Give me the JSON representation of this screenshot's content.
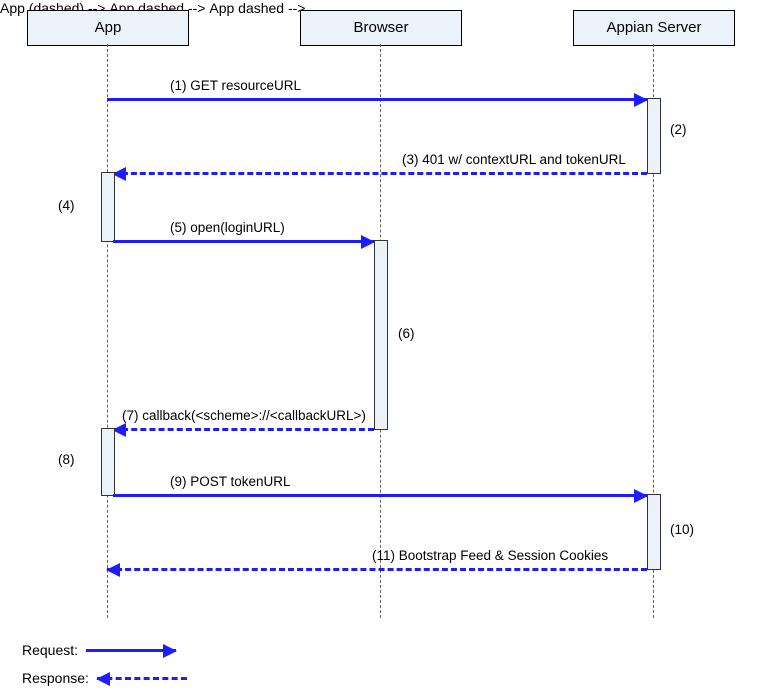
{
  "participants": {
    "app": {
      "label": "App"
    },
    "browser": {
      "label": "Browser"
    },
    "server": {
      "label": "Appian Server"
    }
  },
  "messages": {
    "m1": "(1) GET resourceURL",
    "m3": "(3) 401 w/ contextURL and tokenURL",
    "m5": "(5) open(loginURL)",
    "m7": "(7) callback(<scheme>://<callbackURL>)",
    "m9": "(9) POST tokenURL",
    "m11": "(11) Bootstrap Feed & Session Cookies"
  },
  "activations": {
    "a2": "(2)",
    "a4": "(4)",
    "a6": "(6)",
    "a8": "(8)",
    "a10": "(10)"
  },
  "legend": {
    "request": "Request:",
    "response": "Response:"
  },
  "chart_data": {
    "type": "sequence-diagram",
    "participants": [
      "App",
      "Browser",
      "Appian Server"
    ],
    "events": [
      {
        "n": 1,
        "from": "App",
        "to": "Appian Server",
        "text": "GET resourceURL",
        "kind": "request"
      },
      {
        "n": 2,
        "at": "Appian Server",
        "kind": "activation"
      },
      {
        "n": 3,
        "from": "Appian Server",
        "to": "App",
        "text": "401 w/ contextURL and tokenURL",
        "kind": "response"
      },
      {
        "n": 4,
        "at": "App",
        "kind": "activation"
      },
      {
        "n": 5,
        "from": "App",
        "to": "Browser",
        "text": "open(loginURL)",
        "kind": "request"
      },
      {
        "n": 6,
        "at": "Browser",
        "kind": "activation"
      },
      {
        "n": 7,
        "from": "Browser",
        "to": "App",
        "text": "callback(<scheme>://<callbackURL>)",
        "kind": "response"
      },
      {
        "n": 8,
        "at": "App",
        "kind": "activation"
      },
      {
        "n": 9,
        "from": "App",
        "to": "Appian Server",
        "text": "POST tokenURL",
        "kind": "request"
      },
      {
        "n": 10,
        "at": "Appian Server",
        "kind": "activation"
      },
      {
        "n": 11,
        "from": "Appian Server",
        "to": "App",
        "text": "Bootstrap Feed & Session Cookies",
        "kind": "response"
      }
    ],
    "legend": {
      "request": "solid",
      "response": "dashed"
    }
  }
}
